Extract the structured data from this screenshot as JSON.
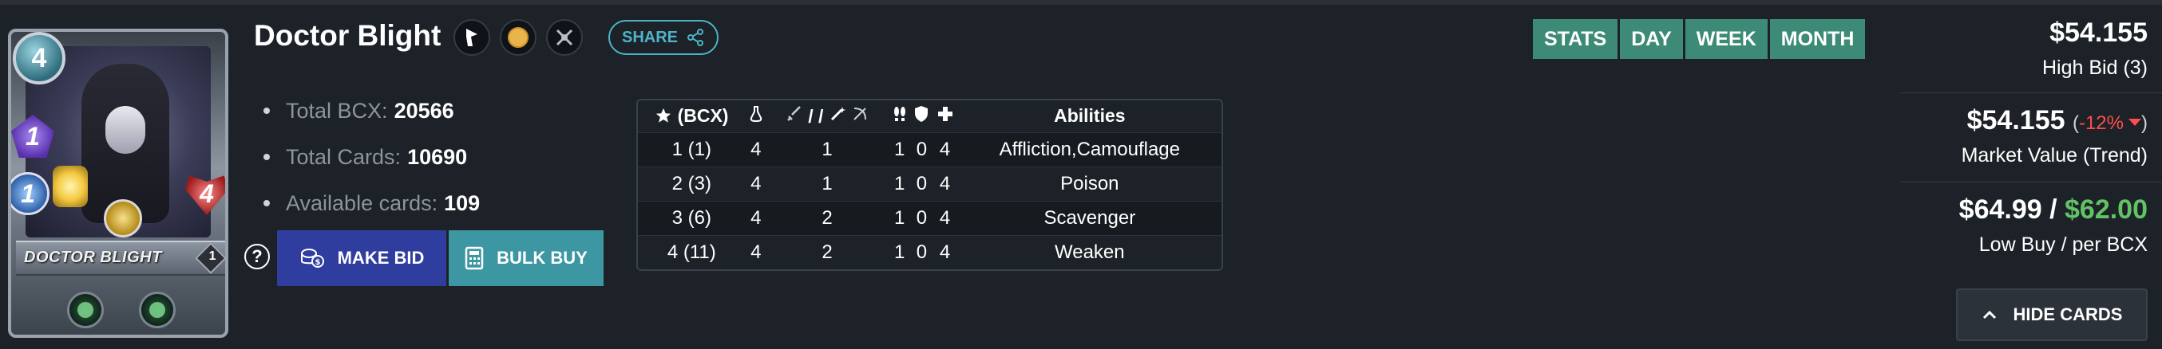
{
  "card": {
    "name": "DOCTOR BLIGHT",
    "mana": "4",
    "magic": "1",
    "speed": "1",
    "health": "4",
    "level": "1",
    "ability_icons": [
      "affliction-icon",
      "camouflage-icon"
    ]
  },
  "header": {
    "title": "Doctor Blight",
    "share_label": "SHARE",
    "icons": [
      "splinter-death-icon",
      "gold-foil-icon",
      "battle-icon"
    ]
  },
  "stats": [
    {
      "label": "Total BCX:",
      "value": "20566"
    },
    {
      "label": "Total Cards:",
      "value": "10690"
    },
    {
      "label": "Available cards:",
      "value": "109"
    }
  ],
  "actions": {
    "help": "?",
    "make_bid": "MAKE BID",
    "bulk_buy": "BULK BUY"
  },
  "level_table": {
    "headers": [
      "(BCX)",
      "",
      "/ /",
      "",
      "",
      "",
      "Abilities"
    ],
    "rows": [
      {
        "level": "1 (1)",
        "mana": "4",
        "attack": "1",
        "speed": "1",
        "armor": "0",
        "health": "4",
        "abilities": "Affliction,Camouflage"
      },
      {
        "level": "2 (3)",
        "mana": "4",
        "attack": "1",
        "speed": "1",
        "armor": "0",
        "health": "4",
        "abilities": "Poison"
      },
      {
        "level": "3 (6)",
        "mana": "4",
        "attack": "2",
        "speed": "1",
        "armor": "0",
        "health": "4",
        "abilities": "Scavenger"
      },
      {
        "level": "4 (11)",
        "mana": "4",
        "attack": "2",
        "speed": "1",
        "armor": "0",
        "health": "4",
        "abilities": "Weaken"
      }
    ]
  },
  "tabs": [
    "STATS",
    "DAY",
    "WEEK",
    "MONTH"
  ],
  "prices": {
    "high_bid": "$54.155",
    "high_bid_label": "High Bid (3)",
    "market_value": "$54.155",
    "trend_open": "(",
    "trend": "-12%",
    "trend_close": ")",
    "market_label": "Market Value (Trend)",
    "low_buy": "$64.99",
    "slash": " / ",
    "per_bcx": "$62.00",
    "low_buy_label": "Low Buy / per BCX",
    "hide_cards": "HIDE CARDS"
  },
  "colors": {
    "background": "#1c2227",
    "make_bid": "#2f3e9e",
    "bulk_buy": "#3d97a3",
    "tab": "#3d8b76",
    "share": "#4fb3c8",
    "trend_down": "#ff4d4d",
    "per_bcx": "#62c265"
  }
}
